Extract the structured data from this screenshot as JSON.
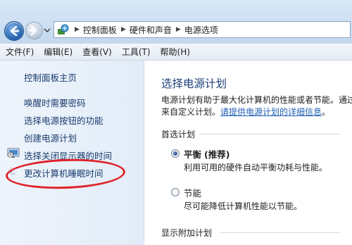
{
  "breadcrumbs": [
    "控制面板",
    "硬件和声音",
    "电源选项"
  ],
  "menu": [
    "文件(F)",
    "编辑(E)",
    "查看(V)",
    "工具(T)",
    "帮助(H)"
  ],
  "sidebar": {
    "home": "控制面板主页",
    "links": [
      "唤醒时需要密码",
      "选择电源按钮的功能",
      "创建电源计划"
    ],
    "icon_links": [
      "选择关闭显示器的时间",
      "更改计算机睡眠时间"
    ]
  },
  "main": {
    "title": "选择电源计划",
    "desc_line1": "电源计划有助于最大化计算机的性能或者节能。通过",
    "desc_line2_prefix": "来自定义计划。",
    "desc_link": "请提供电源计划的详细信息",
    "desc_line2_suffix": "。",
    "preferred_label": "首选计划",
    "plans": [
      {
        "name": "平衡",
        "tag": "(推荐)",
        "desc": "利用可用的硬件自动平衡功耗与性能。",
        "selected": true
      },
      {
        "name": "节能",
        "tag": "",
        "desc": "尽可能降低计算机性能以节能。",
        "selected": false
      }
    ],
    "additional_label": "显示附加计划"
  },
  "colors": {
    "accent": "#2160b5",
    "link": "#1a3c6e",
    "annotation": "#e0222a"
  },
  "icons": {
    "back": "back-arrow-icon",
    "forward": "forward-arrow-icon",
    "address": "control-panel-icon",
    "monitor": "monitor-icon",
    "sleep": "moon-icon"
  }
}
